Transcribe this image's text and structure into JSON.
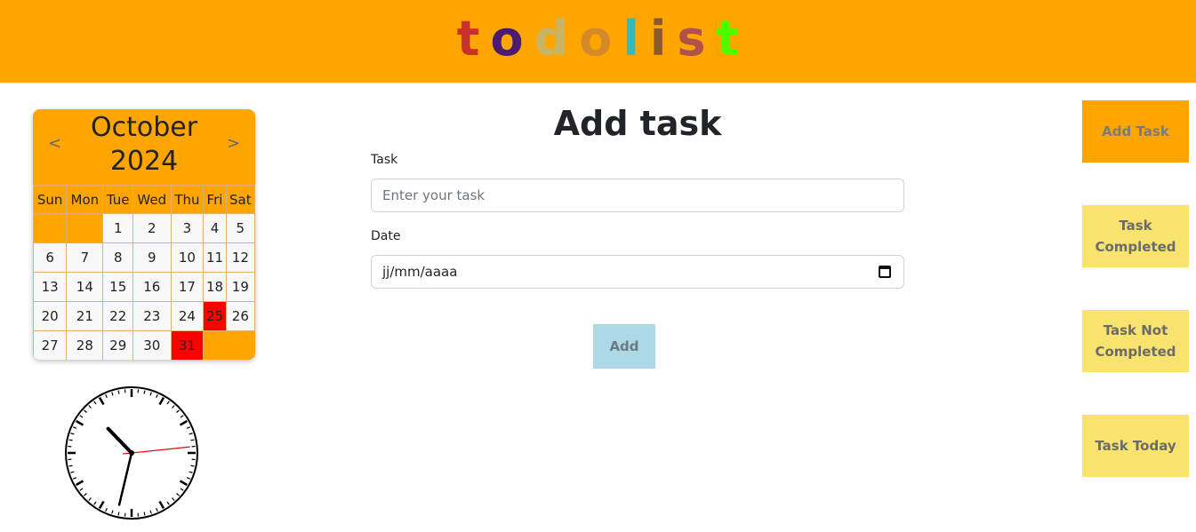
{
  "header": {
    "bg_color": "#ffa500",
    "logo_letters": [
      {
        "ch": "t",
        "color": "#c9302c"
      },
      {
        "ch": "o",
        "color": "#4b1c6e"
      },
      {
        "ch": "d",
        "color": "#c8b464"
      },
      {
        "ch": "o",
        "color": "#d48a28"
      },
      {
        "ch": "l",
        "color": "#3ab8b8"
      },
      {
        "ch": "i",
        "color": "#8b5a2b"
      },
      {
        "ch": "s",
        "color": "#b0524a"
      },
      {
        "ch": "t",
        "color": "#4cff00"
      }
    ]
  },
  "calendar": {
    "month": "October",
    "year": "2024",
    "prev": "<",
    "next": ">",
    "weekdays": [
      "Sun",
      "Mon",
      "Tue",
      "Wed",
      "Thu",
      "Fri",
      "Sat"
    ],
    "weeks": [
      [
        "",
        "",
        "1",
        "2",
        "3",
        "4",
        "5"
      ],
      [
        "6",
        "7",
        "8",
        "9",
        "10",
        "11",
        "12"
      ],
      [
        "13",
        "14",
        "15",
        "16",
        "17",
        "18",
        "19"
      ],
      [
        "20",
        "21",
        "22",
        "23",
        "24",
        "25",
        "26"
      ],
      [
        "27",
        "28",
        "29",
        "30",
        "31",
        "",
        ""
      ]
    ],
    "highlighted_days": [
      "25",
      "31"
    ],
    "highlight_color": "#ff0000"
  },
  "clock": {
    "hour": 10,
    "minute": 32,
    "second": 14
  },
  "form": {
    "title": "Add task",
    "task_label": "Task",
    "task_placeholder": "Enter your task",
    "date_label": "Date",
    "date_placeholder": "jj/mm/aaaa",
    "add_label": "Add"
  },
  "side_buttons": [
    {
      "label": "Add Task",
      "active": true
    },
    {
      "label": "Task Completed",
      "active": false
    },
    {
      "label": "Task Not Completed",
      "active": false
    },
    {
      "label": "Task Today",
      "active": false
    }
  ]
}
